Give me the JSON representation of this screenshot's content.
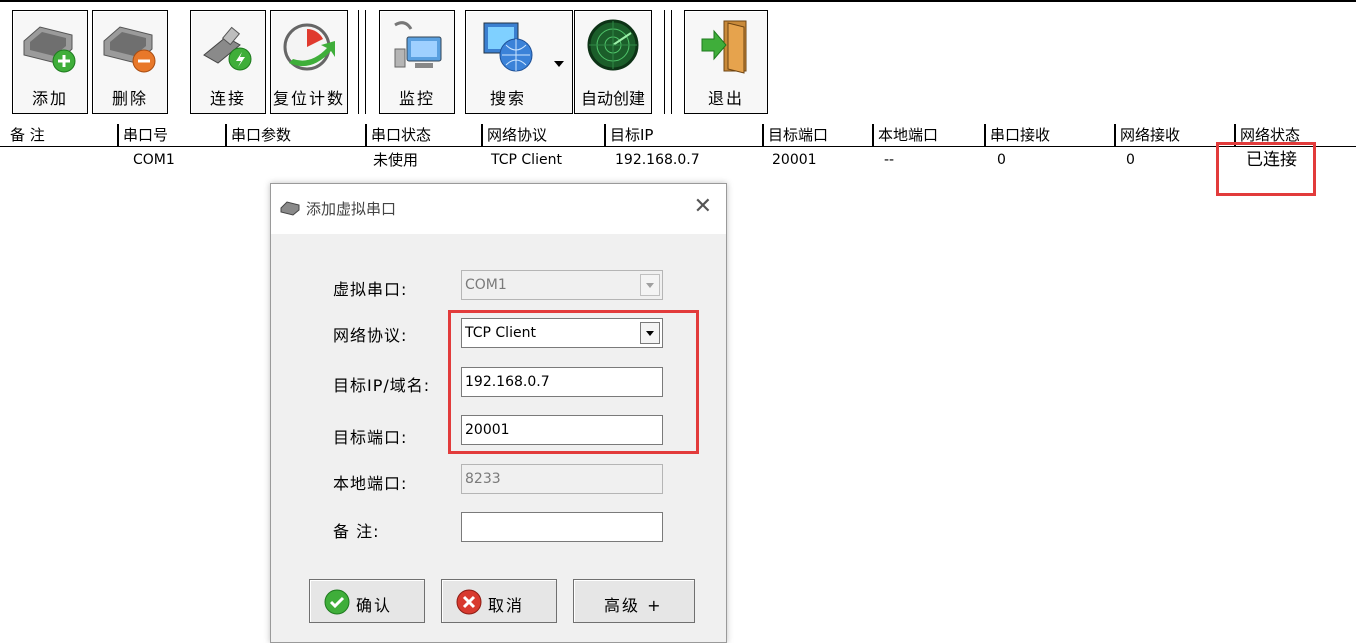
{
  "toolbar": {
    "buttons": [
      {
        "id": "add",
        "label": "添加",
        "icon": "serial-add-icon"
      },
      {
        "id": "delete",
        "label": "删除",
        "icon": "serial-delete-icon"
      },
      {
        "id": "connect",
        "label": "连接",
        "icon": "network-plug-icon"
      },
      {
        "id": "reset",
        "label": "复位计数",
        "icon": "reset-timer-icon"
      },
      {
        "id": "monitor",
        "label": "监控",
        "icon": "monitor-icon"
      },
      {
        "id": "search",
        "label": "搜索",
        "icon": "network-search-icon"
      },
      {
        "id": "auto",
        "label": "自动创建",
        "icon": "radar-icon"
      },
      {
        "id": "exit",
        "label": "退出",
        "icon": "exit-door-icon"
      }
    ]
  },
  "table": {
    "columns": [
      "备 注",
      "串口号",
      "串口参数",
      "串口状态",
      "网络协议",
      "目标IP",
      "目标端口",
      "本地端口",
      "串口接收",
      "网络接收",
      "网络状态"
    ],
    "rows": [
      {
        "remark": "",
        "port": "COM1",
        "params": "",
        "status": "未使用",
        "protocol": "TCP Client",
        "target_ip": "192.168.0.7",
        "target_port": "20001",
        "local_port": "--",
        "serial_rx": "0",
        "net_rx": "0",
        "net_status": "已连接"
      }
    ]
  },
  "dialog": {
    "title": "添加虚拟串口",
    "fields": {
      "virtual_port": {
        "label": "虚拟串口:",
        "value": "COM1"
      },
      "protocol": {
        "label": "网络协议:",
        "value": "TCP Client"
      },
      "target_ip": {
        "label": "目标IP/域名:",
        "value": "192.168.0.7"
      },
      "target_port": {
        "label": "目标端口:",
        "value": "20001"
      },
      "local_port": {
        "label": "本地端口:",
        "value": "8233"
      },
      "remark": {
        "label": "备 注:",
        "value": ""
      }
    },
    "buttons": {
      "ok": "确认",
      "cancel": "取消",
      "advanced": "高级 +"
    }
  },
  "colors": {
    "highlight": "#e23b3b",
    "ok_green": "#3fae3a",
    "cancel_red": "#d83a2f"
  }
}
